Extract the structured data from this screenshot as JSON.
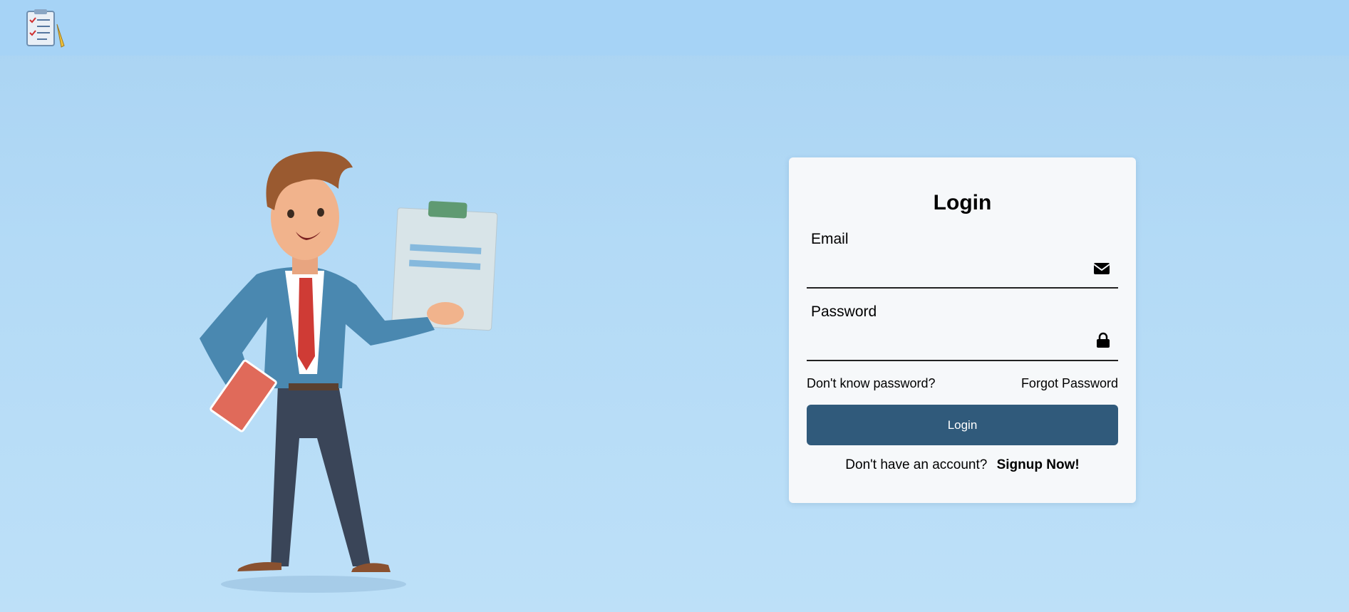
{
  "header": {
    "logo_icon": "clipboard-checklist-pencil-icon"
  },
  "illustration": {
    "icon": "businessman-with-clipboard-illustration"
  },
  "login": {
    "title": "Login",
    "email_label": "Email",
    "email_value": "",
    "email_icon": "envelope-icon",
    "password_label": "Password",
    "password_value": "",
    "password_icon": "lock-icon",
    "dont_know_password": "Don't know password?",
    "forgot_password": "Forgot Password",
    "submit_label": "Login",
    "no_account_text": "Don't have an account?",
    "signup_label": "Signup Now!"
  },
  "colors": {
    "background": "#b3daf6",
    "topbar": "#a6d3f6",
    "card": "#f6f8fa",
    "button": "#305a7b"
  }
}
